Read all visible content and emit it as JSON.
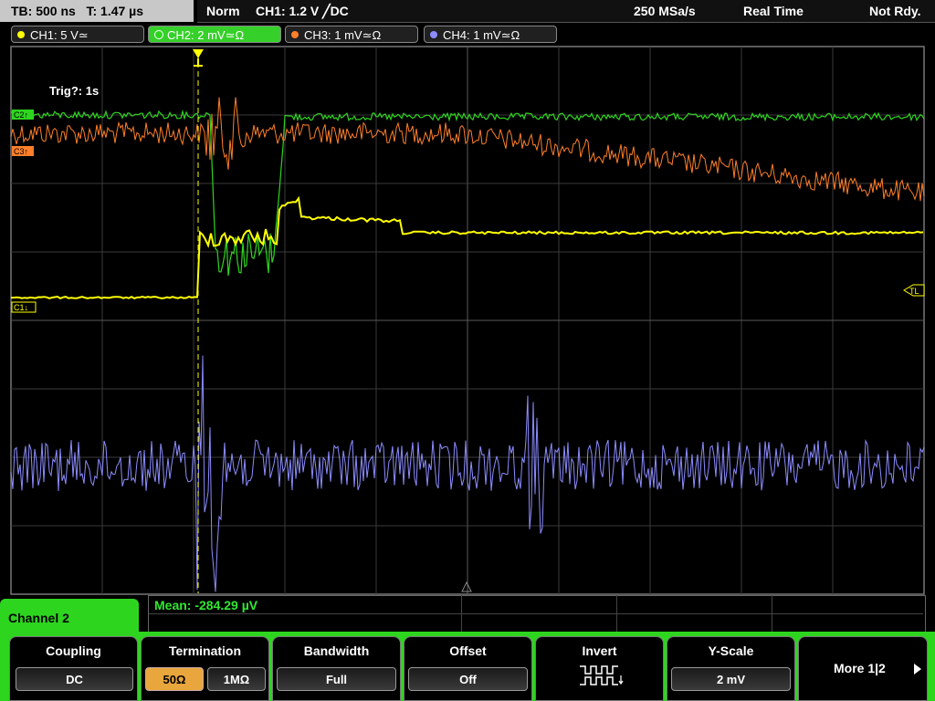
{
  "topbar": {
    "timebase": "TB: 500 ns",
    "trigger_time": "T: 1.47 µs",
    "mode": "Norm",
    "trigger_info": "CH1: 1.2 V ╱DC",
    "sample_rate": "250 MSa/s",
    "acq_mode": "Real Time",
    "status": "Not Rdy."
  },
  "channels": [
    {
      "label": "CH1: 5 V≃",
      "color": "#ffff00"
    },
    {
      "label": "CH2: 2 mV≃Ω",
      "color": "#2ed51f"
    },
    {
      "label": "CH3: 1 mV≃Ω",
      "color": "#ff7f2a"
    },
    {
      "label": "CH4: 1 mV≃Ω",
      "color": "#8c8cff"
    }
  ],
  "screen": {
    "trig_status": "Trig?: 1s",
    "marker_c1": "C1↓",
    "marker_c2": "C2↑",
    "marker_c3": "C3↑",
    "marker_tl": "TL"
  },
  "measurement": {
    "text": "Mean: -284.29 µV"
  },
  "menu": {
    "title": "Channel 2",
    "coupling_title": "Coupling",
    "coupling_value": "DC",
    "termination_title": "Termination",
    "termination_opt1": "50Ω",
    "termination_opt2": "1MΩ",
    "bandwidth_title": "Bandwidth",
    "bandwidth_value": "Full",
    "offset_title": "Offset",
    "offset_value": "Off",
    "invert_title": "Invert",
    "yscale_title": "Y-Scale",
    "yscale_value": "2 mV",
    "more_label": "More 1|2"
  }
}
